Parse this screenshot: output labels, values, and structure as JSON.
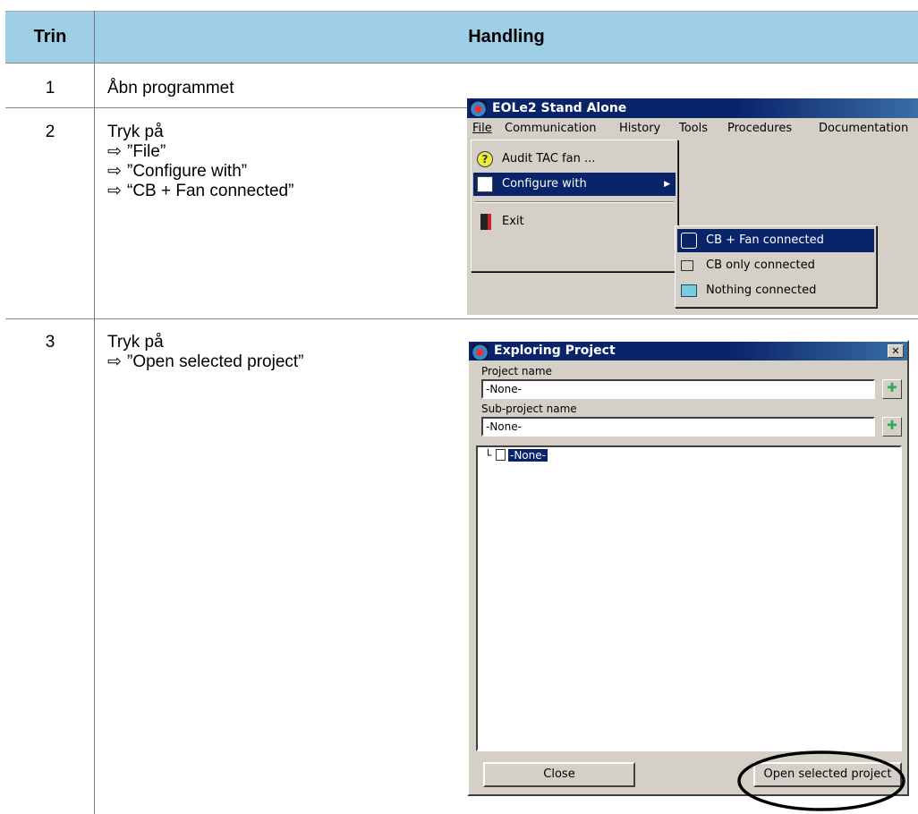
{
  "header": {
    "col1": "Trin",
    "col2": "Handling"
  },
  "rows": [
    {
      "num": "1",
      "text": "Åbn programmet"
    },
    {
      "num": "2",
      "lead": "Tryk på",
      "arrow": "⇨",
      "steps": [
        "”File”",
        "”Configure with”",
        "“CB + Fan connected”"
      ]
    },
    {
      "num": "3",
      "lead": "Tryk på",
      "arrow": "⇨",
      "steps": [
        "”Open selected project”"
      ]
    }
  ],
  "screenshot1": {
    "title": "EOLe2 Stand Alone",
    "menubar": [
      "File",
      "Communication",
      "History",
      "Tools",
      "Procedures",
      "Documentation"
    ],
    "file_menu": [
      "Audit TAC fan ...",
      "Configure with",
      "Exit"
    ],
    "submenu": [
      "CB + Fan connected",
      "CB only connected",
      "Nothing connected"
    ]
  },
  "screenshot2": {
    "title": "Exploring Project",
    "close_glyph": "✕",
    "project_label": "Project name",
    "project_value": "-None-",
    "subproject_label": "Sub-project name",
    "subproject_value": "-None-",
    "tree_node": "-None-",
    "close_button": "Close",
    "open_button": "Open selected project",
    "plus_glyph": "✚"
  },
  "colors": {
    "header_bg": "#9ecfe6",
    "title_bar": "#0a246a",
    "highlight": "#0a246a",
    "circle": "#000000"
  }
}
